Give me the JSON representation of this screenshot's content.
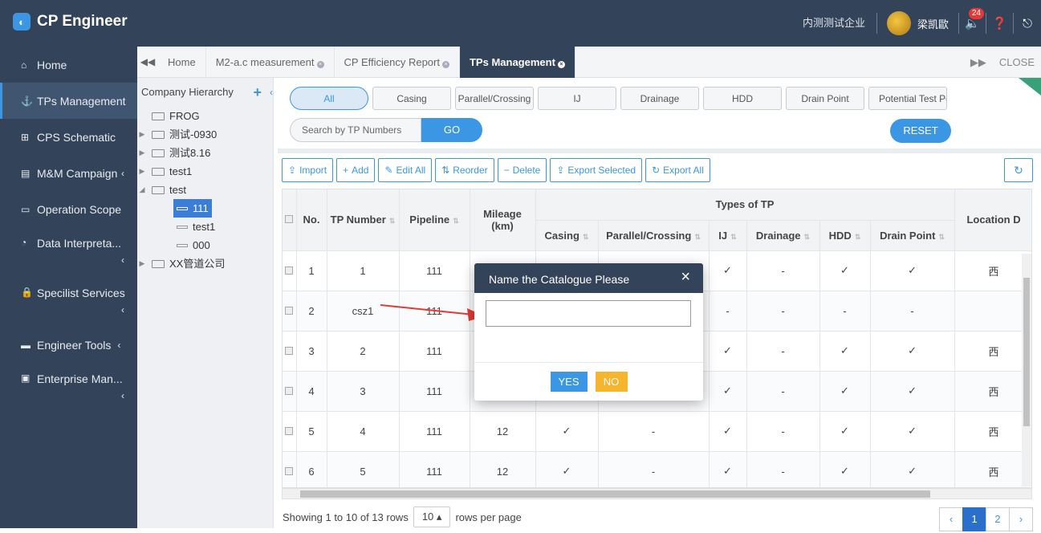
{
  "app": {
    "title": "CP Engineer",
    "company": "内测测试企业",
    "username": "梁凯歐",
    "notification_count": "24",
    "accent": "#3b97e3",
    "nav_bg": "#33435a"
  },
  "sidebar": {
    "items": [
      {
        "label": "Home",
        "icon": "home-icon"
      },
      {
        "label": "TPs Management",
        "icon": "anchor-icon"
      },
      {
        "label": "CPS Schematic",
        "icon": "sitemap-icon"
      },
      {
        "label": "M&M Campaign",
        "icon": "file-icon"
      },
      {
        "label": "Operation Scope",
        "icon": "monitor-icon"
      },
      {
        "label": "Data Interpreta...",
        "icon": "pie-chart-icon"
      },
      {
        "label": "Specilist Services",
        "icon": "lock-icon"
      },
      {
        "label": "Engineer Tools",
        "icon": "card-icon"
      },
      {
        "label": "Enterprise Man...",
        "icon": "briefcase-icon"
      }
    ]
  },
  "tabs": [
    {
      "label": "Home"
    },
    {
      "label": "M2-a.c measurement"
    },
    {
      "label": "CP Efficiency Report"
    },
    {
      "label": "TPs Management"
    }
  ],
  "close_label": "CLOSE",
  "hierarchy": {
    "title": "Company Hierarchy",
    "nodes": [
      "FROG",
      "测试-0930",
      "测试8.16",
      "test1",
      "test",
      "111",
      "test1",
      "000",
      "XX管道公司"
    ]
  },
  "filters": {
    "types": [
      "All",
      "Casing",
      "Parallel/Crossing",
      "IJ",
      "Drainage",
      "HDD",
      "Drain Point",
      "Potential Test Points"
    ],
    "search_placeholder": "Search by TP Numbers",
    "go_label": "GO",
    "reset_label": "RESET"
  },
  "toolbar": {
    "import": "Import",
    "add": "Add",
    "edit_all": "Edit All",
    "reorder": "Reorder",
    "delete": "Delete",
    "export_selected": "Export Selected",
    "export_all": "Export All"
  },
  "table": {
    "headers": {
      "no": "No.",
      "tp_number": "TP Number",
      "pipeline": "Pipeline",
      "mileage": "Mileage",
      "mileage_unit": "(km)",
      "types_of_tp": "Types of TP",
      "casing": "Casing",
      "parallel": "Parallel/Crossing",
      "ij": "IJ",
      "drainage": "Drainage",
      "hdd": "HDD",
      "drain_point": "Drain Point",
      "location": "Location D"
    },
    "rows": [
      {
        "no": "1",
        "tp": "1",
        "pipeline": "111",
        "mileage": "",
        "casing": "",
        "parallel": "",
        "ij": "✓",
        "drainage": "-",
        "hdd": "✓",
        "drain_point": "✓",
        "location": "西"
      },
      {
        "no": "2",
        "tp": "csz1",
        "pipeline": "111",
        "mileage": "",
        "casing": "",
        "parallel": "",
        "ij": "-",
        "drainage": "-",
        "hdd": "-",
        "drain_point": "-",
        "location": ""
      },
      {
        "no": "3",
        "tp": "2",
        "pipeline": "111",
        "mileage": "",
        "casing": "",
        "parallel": "",
        "ij": "✓",
        "drainage": "-",
        "hdd": "✓",
        "drain_point": "✓",
        "location": "西"
      },
      {
        "no": "4",
        "tp": "3",
        "pipeline": "111",
        "mileage": "",
        "casing": "",
        "parallel": "",
        "ij": "✓",
        "drainage": "-",
        "hdd": "✓",
        "drain_point": "✓",
        "location": "西"
      },
      {
        "no": "5",
        "tp": "4",
        "pipeline": "111",
        "mileage": "12",
        "casing": "✓",
        "parallel": "-",
        "ij": "✓",
        "drainage": "-",
        "hdd": "✓",
        "drain_point": "✓",
        "location": "西"
      },
      {
        "no": "6",
        "tp": "5",
        "pipeline": "111",
        "mileage": "12",
        "casing": "✓",
        "parallel": "-",
        "ij": "✓",
        "drainage": "-",
        "hdd": "✓",
        "drain_point": "✓",
        "location": "西"
      }
    ]
  },
  "footer": {
    "showing_text": "Showing 1 to 10 of 13 rows",
    "per_page_value": "10",
    "per_page_suffix": "rows per page",
    "pages": [
      "1",
      "2"
    ],
    "prev": "‹",
    "next": "›"
  },
  "modal": {
    "title": "Name the Catalogue Please",
    "input_value": "",
    "yes_label": "YES",
    "no_label": "NO"
  }
}
